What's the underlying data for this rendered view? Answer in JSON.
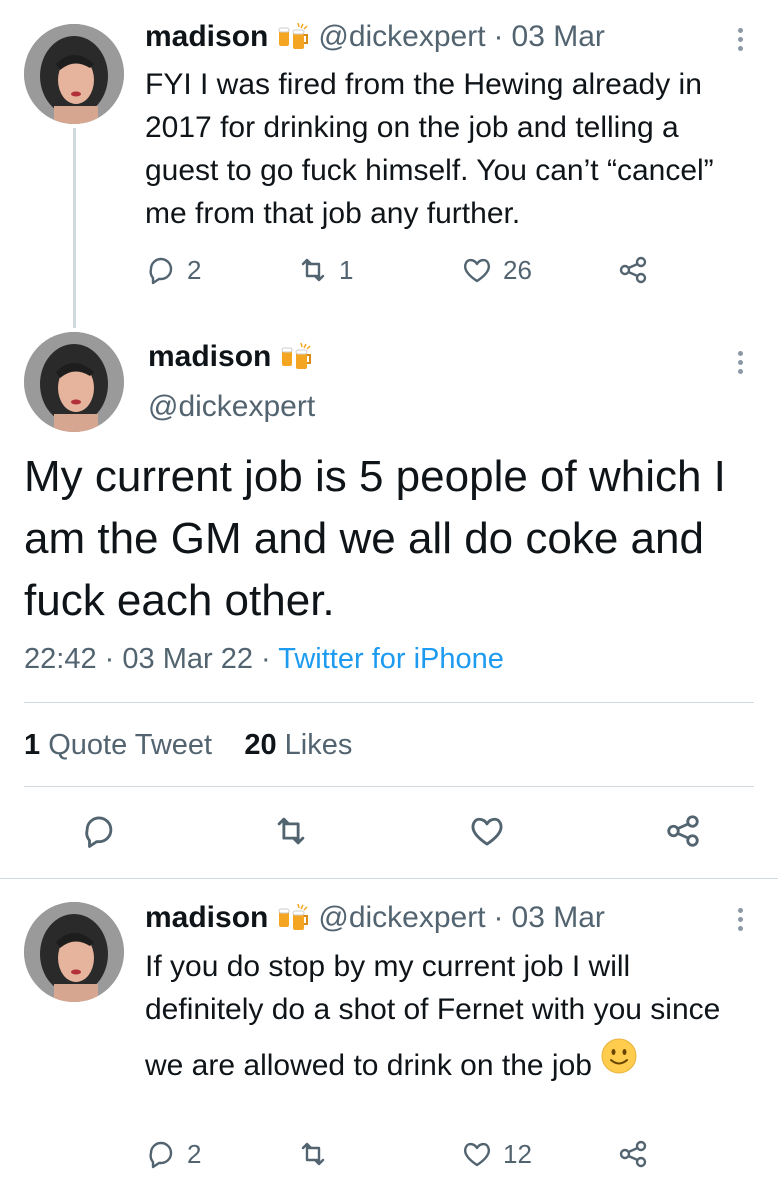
{
  "tweet1": {
    "name": "madison",
    "handle": "@dickexpert",
    "date": "03 Mar",
    "text": "FYI I was fired from the Hewing already in 2017 for drinking on the job and telling a guest to go fuck himself. You can’t “cancel” me from that job any further.",
    "replies": "2",
    "retweets": "1",
    "likes": "26"
  },
  "main_tweet": {
    "name": "madison",
    "handle": "@dickexpert",
    "text": "My current job is 5 people of which I am the GM and we all do coke and fuck each other.",
    "time": "22:42",
    "date": "03 Mar 22",
    "source": "Twitter for iPhone",
    "quote_count": "1",
    "quote_label": "Quote Tweet",
    "like_count": "20",
    "like_label": "Likes"
  },
  "tweet3": {
    "name": "madison",
    "handle": "@dickexpert",
    "date": "03 Mar",
    "text": "If you do stop by my current job I will definitely do a shot of Fernet with you since we are allowed to drink on the job",
    "replies": "2",
    "likes": "12"
  },
  "separator": "·",
  "colors": {
    "accent": "#1d9bf0",
    "muted": "#536471",
    "divider": "#cfd9de"
  },
  "icons": [
    "reply-icon",
    "retweet-icon",
    "like-icon",
    "share-icon",
    "more-icon",
    "beer-emoji-icon",
    "smiley-emoji-icon"
  ]
}
